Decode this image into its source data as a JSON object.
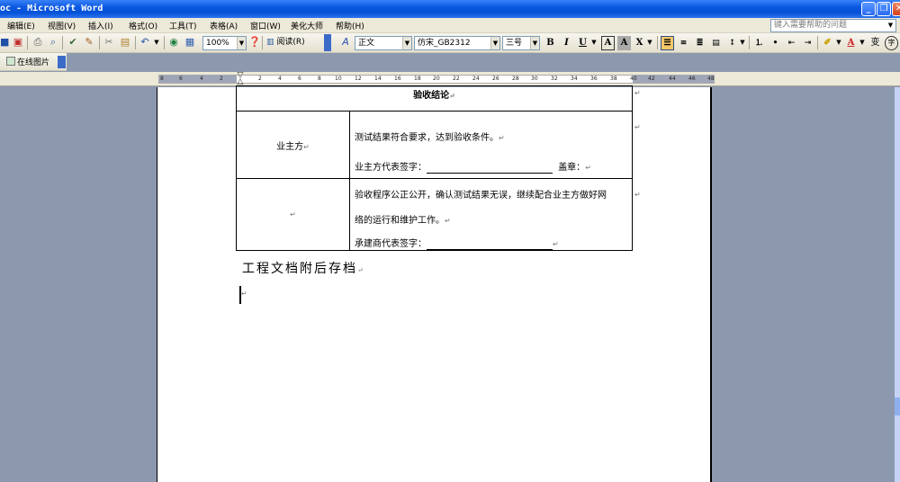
{
  "window": {
    "title": "oc - Microsoft Word",
    "minimize_label": "_",
    "maximize_label": "❐",
    "close_label": "✕"
  },
  "menubar": {
    "items": [
      {
        "label": "编辑(E)"
      },
      {
        "label": "视图(V)"
      },
      {
        "label": "插入(I)"
      },
      {
        "label": "格式(O)"
      },
      {
        "label": "工具(T)"
      },
      {
        "label": "表格(A)"
      },
      {
        "label": "窗口(W)"
      },
      {
        "label": "美化大师"
      },
      {
        "label": "帮助(H)"
      }
    ],
    "help_placeholder": "键入需要帮助的问题"
  },
  "toolbar": {
    "zoom": "100%",
    "read_label": "阅读(R)",
    "style": "正文",
    "font": "仿宋_GB2312",
    "size": "三号",
    "bold": "B",
    "italic": "I",
    "underline": "U",
    "char_border": "A",
    "char_shade": "A",
    "scale": "X",
    "font_color": "A",
    "phonetic": "变",
    "enclose": "字",
    "accent": "#f2c869"
  },
  "toolbar2": {
    "online_pictures": "在线图片"
  },
  "ruler": {
    "labels": [
      "8",
      "6",
      "4",
      "2",
      "2",
      "4",
      "6",
      "8",
      "10",
      "12",
      "14",
      "16",
      "18",
      "20",
      "22",
      "24",
      "26",
      "28",
      "30",
      "32",
      "34",
      "36",
      "38",
      "40",
      "42",
      "44",
      "46",
      "48"
    ]
  },
  "document": {
    "table": {
      "header": "验收结论",
      "rows": [
        {
          "left": "业主方",
          "lines": [
            "测试结果符合要求，达到验收条件。"
          ],
          "signature_label": "业主方代表签字：",
          "seal_label": "盖章："
        },
        {
          "left": "",
          "lines": [
            "验收程序公正公开，确认测试结果无误，继续配合业主方做好网",
            "络的运行和维护工作。"
          ],
          "signature_label": "承建商代表签字："
        }
      ]
    },
    "archive_note": "工程文档附后存档"
  }
}
